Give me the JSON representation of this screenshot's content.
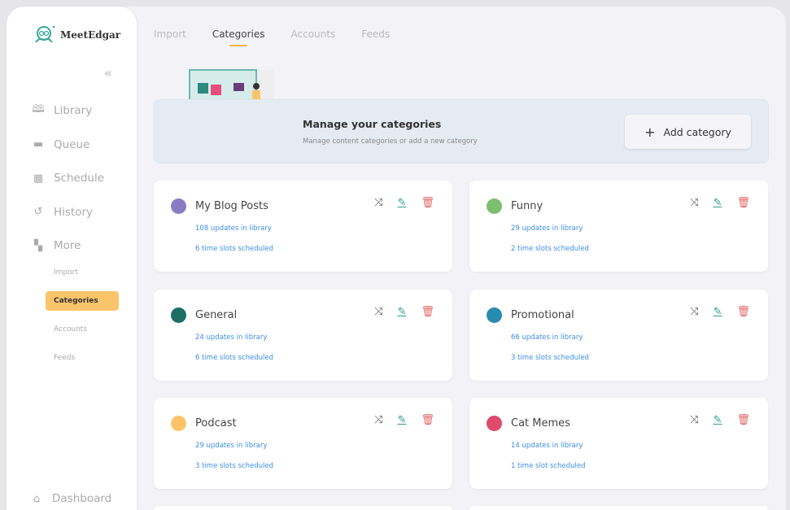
{
  "brand": "MeetEdgar",
  "sidebar": {
    "nav": [
      {
        "label": "Library",
        "icon": "book-icon"
      },
      {
        "label": "Queue",
        "icon": "stack-icon"
      },
      {
        "label": "Schedule",
        "icon": "calendar-icon"
      },
      {
        "label": "History",
        "icon": "history-icon"
      },
      {
        "label": "More",
        "icon": "grid-icon"
      }
    ],
    "sub": [
      {
        "label": "Import"
      },
      {
        "label": "Categories",
        "active": true
      },
      {
        "label": "Accounts"
      },
      {
        "label": "Feeds"
      }
    ],
    "dashboard": "Dashboard"
  },
  "tabs": [
    {
      "label": "Import"
    },
    {
      "label": "Categories",
      "active": true
    },
    {
      "label": "Accounts"
    },
    {
      "label": "Feeds"
    }
  ],
  "banner": {
    "title": "Manage your categories",
    "subtitle": "Manage content categories or add a new category",
    "add_label": "Add category"
  },
  "categories": [
    {
      "name": "My Blog Posts",
      "color": "#8a7cc4",
      "library": "108 updates in library",
      "slots": "6 time slots scheduled"
    },
    {
      "name": "Funny",
      "color": "#7cbf6f",
      "library": "29 updates in library",
      "slots": "2 time slots scheduled"
    },
    {
      "name": "General",
      "color": "#1f6e66",
      "library": "24 updates in library",
      "slots": "6 time slots scheduled"
    },
    {
      "name": "Promotional",
      "color": "#2a8bb0",
      "library": "66 updates in library",
      "slots": "3 time slots scheduled"
    },
    {
      "name": "Podcast",
      "color": "#fbc46a",
      "library": "29 updates in library",
      "slots": "3 time slots scheduled"
    },
    {
      "name": "Cat Memes",
      "color": "#e04a6d",
      "library": "14 updates in library",
      "slots": "1 time slot scheduled"
    }
  ]
}
